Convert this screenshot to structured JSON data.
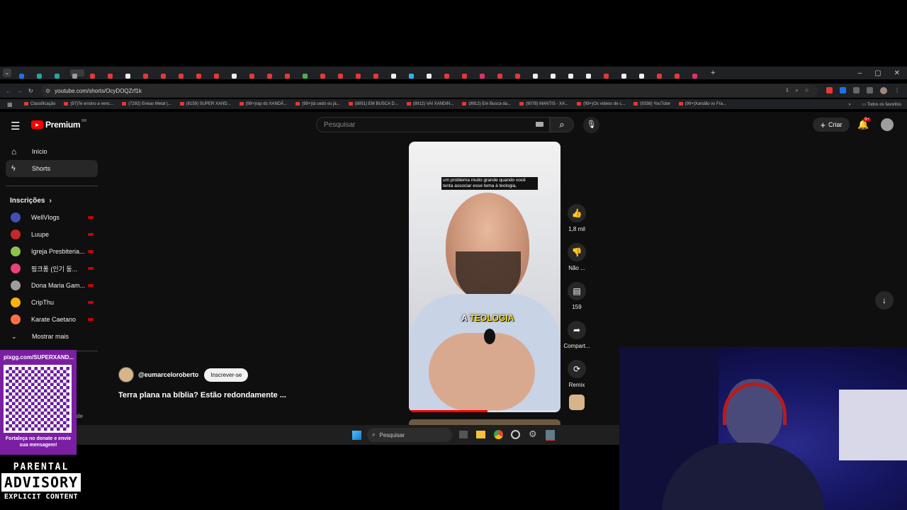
{
  "browser": {
    "url": "youtube.com/shorts/OcyDOQZrf1k",
    "bookmarks": [
      "Classificação",
      "(97)Te ensino a venc...",
      "(7292) Enéas Metal |...",
      "(8159) SUPER XAND...",
      "(99+)rap do XANDÃ...",
      "(99+)tá cedo ou já...",
      "(8851) EM BUSCA D...",
      "(8912) VAI XANDIN...",
      "(8912) Em Busca da...",
      "(9078) MANTIS - XA...",
      "(99+)Os vídeos de c...",
      "(9338) YouTube",
      "(99+)Xandão vs Fra..."
    ],
    "all_bookmarks": "Todos os favoritos"
  },
  "youtube": {
    "logo": "Premium",
    "region": "BR",
    "search_placeholder": "Pesquisar",
    "create_label": "Criar",
    "notifications_badge": "9+",
    "nav": {
      "home": "Início",
      "shorts": "Shorts",
      "subscriptions": "Inscrições",
      "show_more": "Mostrar mais"
    },
    "channels": [
      {
        "name": "WellVlogs",
        "color": "#3f51b5"
      },
      {
        "name": "Luupe",
        "color": "#c62828"
      },
      {
        "name": "Igreja Presbiteria...",
        "color": "#8bc34a"
      },
      {
        "name": "핑크퐁 (인기 동...",
        "color": "#ec407a"
      },
      {
        "name": "Dona Maria Gam...",
        "color": "#9e9e9e"
      },
      {
        "name": "CripThu",
        "color": "#ffb300"
      },
      {
        "name": "Karate Caetano",
        "color": "#ff7043"
      }
    ],
    "short": {
      "channel": "@eumarceloroberto",
      "subscribe": "Inscrever-se",
      "title": "Terra plana na bíblia? Estão redondamente ...",
      "caption_top": "um problema muito grande quando você tenta associar esse tema à teologia,",
      "caption_big_a": "A",
      "caption_big_b": "TEOLOGIA"
    },
    "actions": {
      "likes": "1,8 mil",
      "dislike": "Não ...",
      "comments": "159",
      "share": "Compart...",
      "remix": "Remix"
    }
  },
  "taskbar": {
    "search_placeholder": "Pesquisar"
  },
  "overlay": {
    "pix_url": "pixgg.com/SUPERXAND...",
    "pix_text": "Fortaleça no donate e envie sua mensagem!",
    "side_fragment": "de",
    "advisory_top": "PARENTAL",
    "advisory_mid": "ADVISORY",
    "advisory_bottom": "EXPLICIT CONTENT"
  }
}
